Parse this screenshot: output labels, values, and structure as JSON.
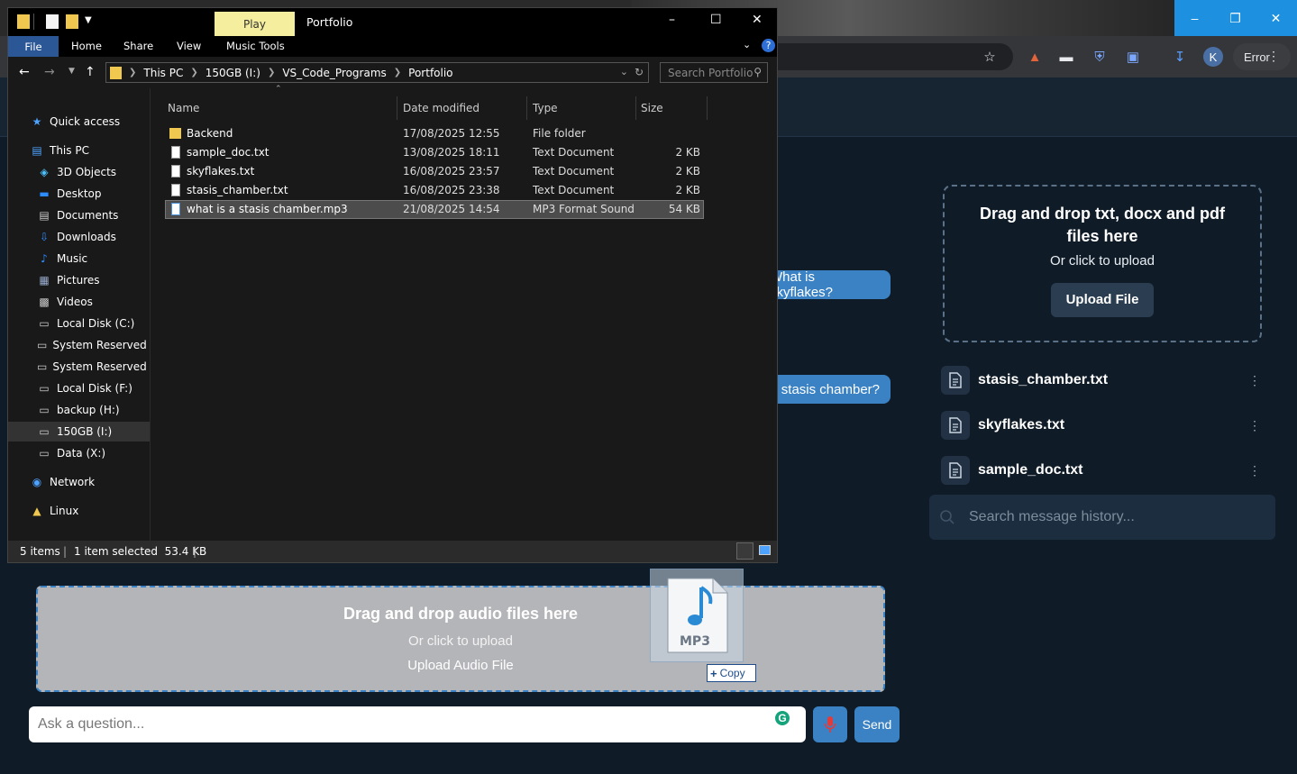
{
  "browser": {
    "profile_initial": "K",
    "error_label": "Error"
  },
  "chat": {
    "bubble_1": "What is skyflakes?",
    "bubble_2": "What is a stasis chamber?"
  },
  "doc_upload": {
    "title": "Drag and drop txt, docx and pdf files here",
    "subtitle": "Or click to upload",
    "button": "Upload File"
  },
  "documents": [
    {
      "name": "stasis_chamber.txt"
    },
    {
      "name": "skyflakes.txt"
    },
    {
      "name": "sample_doc.txt"
    }
  ],
  "history_search": {
    "placeholder": "Search message history..."
  },
  "audio_upload": {
    "title": "Drag and drop audio files here",
    "subtitle": "Or click to upload",
    "button": "Upload Audio File"
  },
  "composer": {
    "placeholder": "Ask a question...",
    "send_label": "Send"
  },
  "drag": {
    "file_label": "MP3",
    "copy_label": "Copy"
  },
  "explorer": {
    "title": "Portfolio",
    "context_tab": "Play",
    "ribbon_tabs": [
      "File",
      "Home",
      "Share",
      "View",
      "Music Tools"
    ],
    "breadcrumb": [
      "This PC",
      "150GB (I:)",
      "VS_Code_Programs",
      "Portfolio"
    ],
    "search_placeholder": "Search Portfolio",
    "nav": [
      {
        "label": "Quick access",
        "icon": "star-icon"
      },
      {
        "label": "This PC",
        "icon": "pc-icon"
      },
      {
        "label": "3D Objects",
        "icon": "cube-icon"
      },
      {
        "label": "Desktop",
        "icon": "desktop-icon"
      },
      {
        "label": "Documents",
        "icon": "documents-icon"
      },
      {
        "label": "Downloads",
        "icon": "download-icon"
      },
      {
        "label": "Music",
        "icon": "music-icon"
      },
      {
        "label": "Pictures",
        "icon": "pictures-icon"
      },
      {
        "label": "Videos",
        "icon": "videos-icon"
      },
      {
        "label": "Local Disk (C:)",
        "icon": "drive-icon"
      },
      {
        "label": "System Reserved (D",
        "icon": "drive-icon"
      },
      {
        "label": "System Reserved (E:",
        "icon": "drive-icon"
      },
      {
        "label": "Local Disk (F:)",
        "icon": "drive-icon"
      },
      {
        "label": "backup (H:)",
        "icon": "drive-icon"
      },
      {
        "label": "150GB (I:)",
        "icon": "drive-icon"
      },
      {
        "label": "Data (X:)",
        "icon": "drive-icon"
      },
      {
        "label": "Network",
        "icon": "network-icon"
      },
      {
        "label": "Linux",
        "icon": "linux-icon"
      }
    ],
    "columns": [
      "Name",
      "Date modified",
      "Type",
      "Size"
    ],
    "files": [
      {
        "name": "Backend",
        "date": "17/08/2025 12:55",
        "type": "File folder",
        "size": "",
        "icon": "folder-icon"
      },
      {
        "name": "sample_doc.txt",
        "date": "13/08/2025 18:11",
        "type": "Text Document",
        "size": "2 KB",
        "icon": "text-file-icon"
      },
      {
        "name": "skyflakes.txt",
        "date": "16/08/2025 23:57",
        "type": "Text Document",
        "size": "2 KB",
        "icon": "text-file-icon"
      },
      {
        "name": "stasis_chamber.txt",
        "date": "16/08/2025 23:38",
        "type": "Text Document",
        "size": "2 KB",
        "icon": "text-file-icon"
      },
      {
        "name": "what is a stasis chamber.mp3",
        "date": "21/08/2025 14:54",
        "type": "MP3 Format Sound",
        "size": "54 KB",
        "icon": "mp3-file-icon",
        "selected": true
      }
    ],
    "status": {
      "count": "5 items",
      "selection": "1 item selected  53.4 KB"
    }
  },
  "colors": {
    "app_bg": "#0f1b27",
    "accent": "#3b82c4",
    "explorer_bg": "#191919"
  }
}
